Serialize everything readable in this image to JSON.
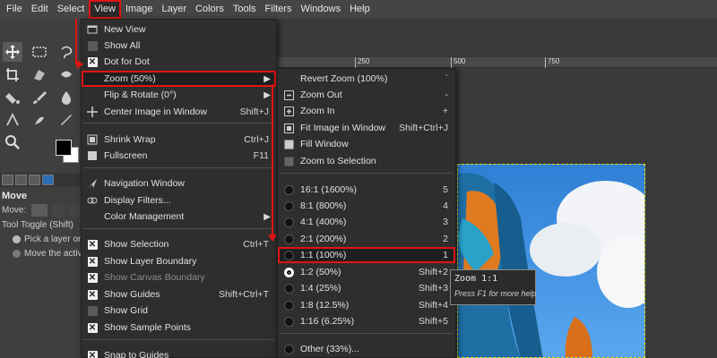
{
  "menubar": {
    "items": [
      "File",
      "Edit",
      "Select",
      "View",
      "Image",
      "Layer",
      "Colors",
      "Tools",
      "Filters",
      "Windows",
      "Help"
    ],
    "active": "View"
  },
  "ruler": {
    "ticks": [
      "250",
      "500",
      "750"
    ]
  },
  "tool_options": {
    "tab_title": "Move",
    "move_label": "Move:",
    "toggle_label": "Tool Toggle  (Shift)",
    "option1": "Pick a layer or",
    "option2": "Move the activ"
  },
  "view_menu": {
    "items": [
      {
        "label": "New View",
        "icon": "new-view-icon",
        "accel": ""
      },
      {
        "label": "Show All",
        "icon": "checkbox-off",
        "accel": ""
      },
      {
        "label": "Dot for Dot",
        "icon": "checkbox-on",
        "accel": ""
      },
      {
        "label": "Zoom (50%)",
        "icon": "",
        "accel": ""
      },
      {
        "label": "Flip & Rotate (0°)",
        "icon": "",
        "accel": ""
      },
      {
        "label": "Center Image in Window",
        "icon": "center-icon",
        "accel": "Shift+J"
      },
      {
        "label": "Shrink Wrap",
        "icon": "shrink-wrap-icon",
        "accel": "Ctrl+J"
      },
      {
        "label": "Fullscreen",
        "icon": "fullscreen-icon",
        "accel": "F11"
      },
      {
        "label": "Navigation Window",
        "icon": "navigation-icon",
        "accel": ""
      },
      {
        "label": "Display Filters...",
        "icon": "display-filters-icon",
        "accel": ""
      },
      {
        "label": "Color Management",
        "icon": "",
        "accel": ""
      },
      {
        "label": "Show Selection",
        "icon": "checkbox-on",
        "accel": "Ctrl+T"
      },
      {
        "label": "Show Layer Boundary",
        "icon": "checkbox-on",
        "accel": ""
      },
      {
        "label": "Show Canvas Boundary",
        "icon": "checkbox-on",
        "accel": ""
      },
      {
        "label": "Show Guides",
        "icon": "checkbox-on",
        "accel": "Shift+Ctrl+T"
      },
      {
        "label": "Show Grid",
        "icon": "checkbox-off",
        "accel": ""
      },
      {
        "label": "Show Sample Points",
        "icon": "checkbox-on",
        "accel": ""
      },
      {
        "label": "Snap to Guides",
        "icon": "checkbox-on",
        "accel": ""
      }
    ]
  },
  "zoom_menu": {
    "items": [
      {
        "label": "Revert Zoom (100%)",
        "accel": "`"
      },
      {
        "label": "Zoom Out",
        "accel": "-"
      },
      {
        "label": "Zoom In",
        "accel": "+"
      },
      {
        "label": "Fit Image in Window",
        "accel": "Shift+Ctrl+J"
      },
      {
        "label": "Fill Window",
        "accel": ""
      },
      {
        "label": "Zoom to Selection",
        "accel": ""
      },
      {
        "label": "16:1  (1600%)",
        "accel": "5"
      },
      {
        "label": "8:1  (800%)",
        "accel": "4"
      },
      {
        "label": "4:1  (400%)",
        "accel": "3"
      },
      {
        "label": "2:1  (200%)",
        "accel": "2"
      },
      {
        "label": "1:1  (100%)",
        "accel": "1"
      },
      {
        "label": "1:2  (50%)",
        "accel": "Shift+2"
      },
      {
        "label": "1:4  (25%)",
        "accel": "Shift+3"
      },
      {
        "label": "1:8  (12.5%)",
        "accel": "Shift+4"
      },
      {
        "label": "1:16  (6.25%)",
        "accel": "Shift+5"
      },
      {
        "label": "Other (33%)...",
        "accel": ""
      }
    ]
  },
  "tooltip": {
    "title": "Zoom 1:1",
    "hint": "Press F1 for more help"
  },
  "colors": {
    "annotation": "#e01414",
    "selection_border": "#e8e000"
  }
}
